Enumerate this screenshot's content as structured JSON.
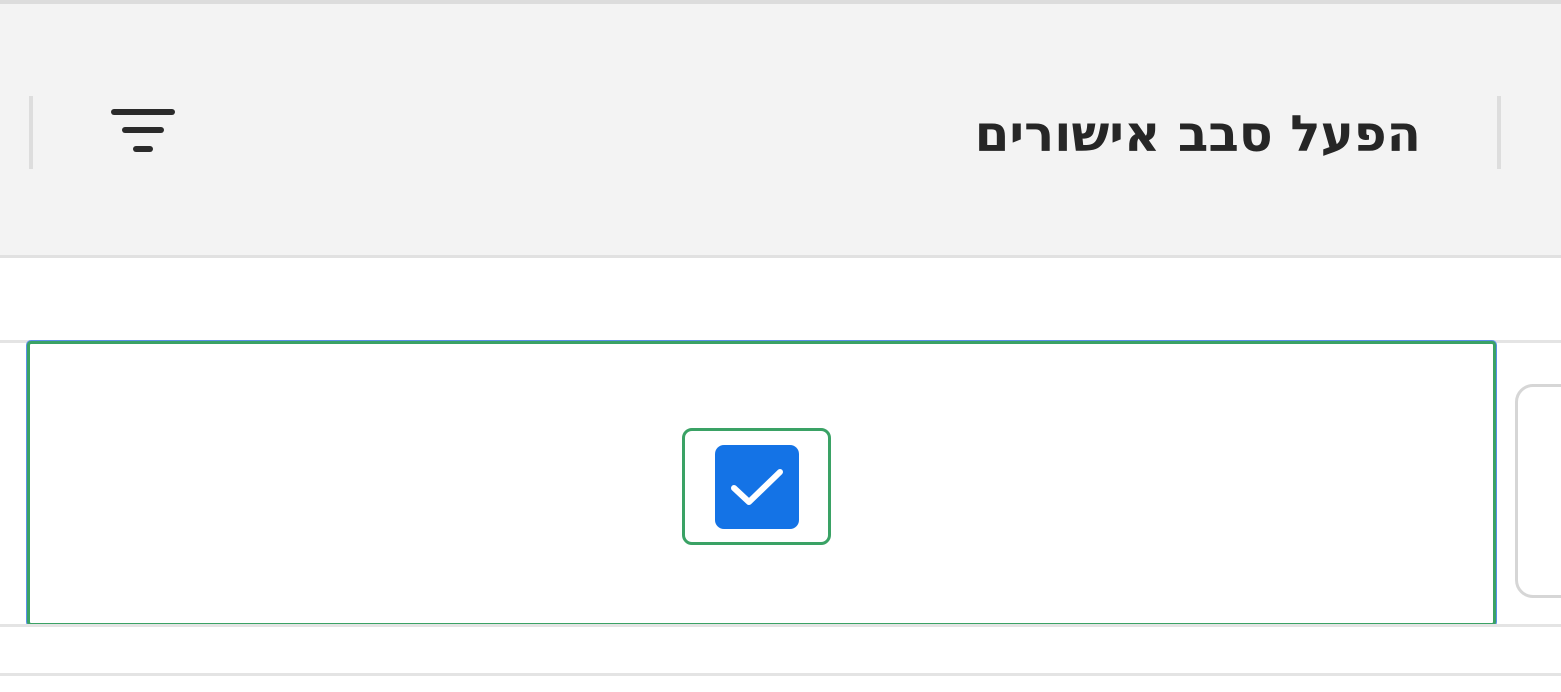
{
  "header": {
    "column_title": "הפעל סבב אישורים",
    "filter_icon": "filter-icon"
  },
  "row": {
    "checkbox_checked": true,
    "checkbox_icon": "checkmark-icon"
  },
  "colors": {
    "header_background": "#f3f3f3",
    "focus_outline": "#3aa265",
    "checkbox_fill": "#1473e6",
    "title_text": "#262626"
  }
}
